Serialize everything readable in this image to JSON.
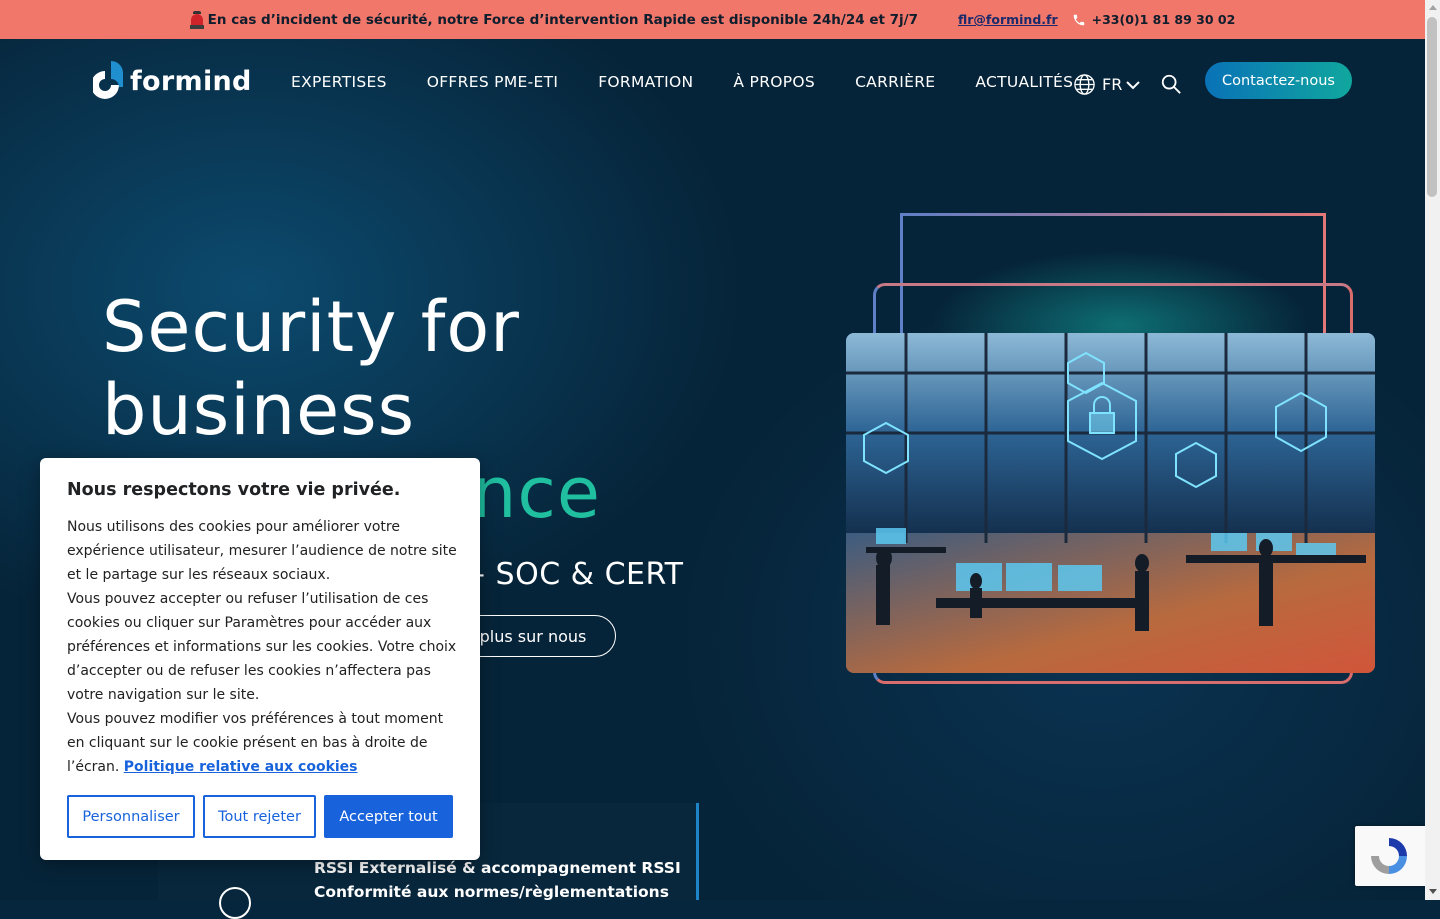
{
  "alert_bar": {
    "message": "En cas d’incident de sécurité, notre Force d’intervention Rapide est disponible 24h/24 et 7j/7",
    "email": "flr@formind.fr",
    "phone": "+33(0)1 81 89 30 02"
  },
  "header": {
    "logo_text": "formind",
    "nav": [
      "EXPERTISES",
      "OFFRES PME-ETI",
      "FORMATION",
      "À PROPOS",
      "CARRIÈRE",
      "ACTUALITÉS"
    ],
    "language": "FR",
    "contact_label": "Contactez-nous"
  },
  "hero": {
    "title_line1": "Security for",
    "title_line2": "business",
    "title_line3_visible": "nce",
    "subtitle_visible": "– SOC & CERT",
    "cta_visible": "plus sur nous"
  },
  "service_card": {
    "line1": "RSSI Externalisé & accompagnement RSSI",
    "line2": "Conformité aux normes/règlementations"
  },
  "cookie_banner": {
    "title": "Nous respectons votre vie privée.",
    "paragraph1": "Nous utilisons des cookies pour améliorer votre expérience utilisateur, mesurer l’audience de notre site et le partage sur les réseaux sociaux.",
    "paragraph2": "Vous pouvez accepter ou refuser l’utilisation de ces cookies ou cliquer sur Paramètres pour accéder aux préférences et informations sur les cookies. Votre choix d’accepter ou de refuser les cookies n’affectera pas votre navigation sur le site.",
    "paragraph3": "Vous pouvez modifier vos préférences à tout moment en cliquant sur le cookie présent en bas à droite de l’écran.",
    "policy_link": "Politique relative aux cookies",
    "customize_label": "Personnaliser",
    "reject_label": "Tout rejeter",
    "accept_label": "Accepter tout"
  },
  "colors": {
    "alert_bg": "#f0776a",
    "hero_bg": "#062439",
    "accent_teal": "#1fbfa0",
    "cookie_primary": "#1863dc"
  }
}
